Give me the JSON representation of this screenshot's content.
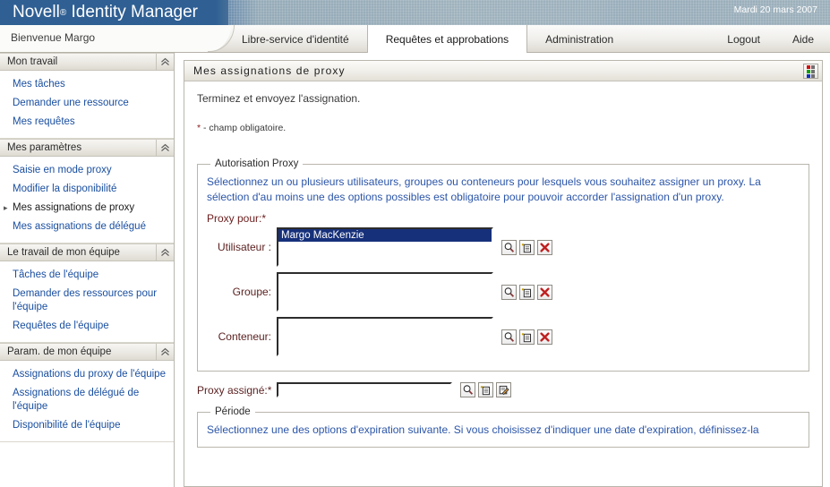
{
  "banner": {
    "brand_name": "Novell",
    "brand_reg": "®",
    "product": "Identity Manager",
    "date": "Mardi 20 mars 2007"
  },
  "tabstrip": {
    "welcome": "Bienvenue Margo",
    "tabs": [
      {
        "label": "Libre-service d'identité",
        "active": false
      },
      {
        "label": "Requêtes et approbations",
        "active": true
      },
      {
        "label": "Administration",
        "active": false
      }
    ],
    "right_links": [
      {
        "label": "Logout"
      },
      {
        "label": "Aide"
      }
    ]
  },
  "sidebar": {
    "groups": [
      {
        "title": "Mon travail",
        "collapse_icon": "chevron-up-double-icon",
        "items": [
          {
            "label": "Mes tâches",
            "current": false
          },
          {
            "label": "Demander une ressource",
            "current": false
          },
          {
            "label": "Mes requêtes",
            "current": false
          }
        ]
      },
      {
        "title": "Mes paramètres",
        "collapse_icon": "chevron-up-double-icon",
        "items": [
          {
            "label": "Saisie en mode proxy",
            "current": false
          },
          {
            "label": "Modifier la disponibilité",
            "current": false
          },
          {
            "label": "Mes assignations de proxy",
            "current": true
          },
          {
            "label": "Mes assignations de délégué",
            "current": false
          }
        ]
      },
      {
        "title": "Le travail de mon équipe",
        "collapse_icon": "chevron-up-double-icon",
        "items": [
          {
            "label": "Tâches de l'équipe",
            "current": false
          },
          {
            "label": "Demander des ressources pour l'équipe",
            "current": false
          },
          {
            "label": "Requêtes de l'équipe",
            "current": false
          }
        ]
      },
      {
        "title": "Param. de mon équipe",
        "collapse_icon": "chevron-up-double-icon",
        "items": [
          {
            "label": "Assignations du proxy de l'équipe",
            "current": false
          },
          {
            "label": "Assignations de délégué de l'équipe",
            "current": false
          },
          {
            "label": "Disponibilité de l'équipe",
            "current": false
          }
        ]
      }
    ]
  },
  "panel": {
    "title": "Mes assignations de proxy",
    "corner_icon": "color-grid-icon",
    "intro": "Terminez et envoyez l'assignation.",
    "required_star": "*",
    "required_note": " - champ obligatoire.",
    "authorization": {
      "legend": "Autorisation Proxy",
      "blurb": "Sélectionnez un ou plusieurs utilisateurs, groupes ou conteneurs pour lesquels vous souhaitez assigner un proxy. La sélection d'au moins une des options possibles est obligatoire pour pouvoir accorder l'assignation d'un proxy.",
      "proxy_for_label": "Proxy pour:",
      "proxy_for_star": "*",
      "rows": [
        {
          "label": "Utilisateur :",
          "options": [
            "Margo MacKenzie"
          ],
          "selected": "Margo MacKenzie",
          "icons": [
            "search-icon",
            "add-entry-icon",
            "delete-icon"
          ]
        },
        {
          "label": "Groupe:",
          "options": [],
          "selected": "",
          "icons": [
            "search-icon",
            "add-entry-icon",
            "delete-icon"
          ]
        },
        {
          "label": "Conteneur:",
          "options": [],
          "selected": "",
          "icons": [
            "search-icon",
            "add-entry-icon",
            "delete-icon"
          ]
        }
      ]
    },
    "assigned": {
      "label": "Proxy assigné:",
      "star": "*",
      "value": "",
      "placeholder": "",
      "icons": [
        "search-icon",
        "add-entry-icon",
        "edit-icon"
      ]
    },
    "period": {
      "legend": "Période",
      "blurb": "Sélectionnez une des options d'expiration suivante. Si vous choisissez d'indiquer une date d'expiration, définissez-la"
    }
  },
  "colors": {
    "banner_blue": "#2f5f93",
    "link_blue": "#1a4fa0",
    "blurb_blue": "#2b55a8",
    "label_maroon": "#5a1f1f",
    "selection_navy": "#16307a",
    "delete_red": "#c02020"
  }
}
